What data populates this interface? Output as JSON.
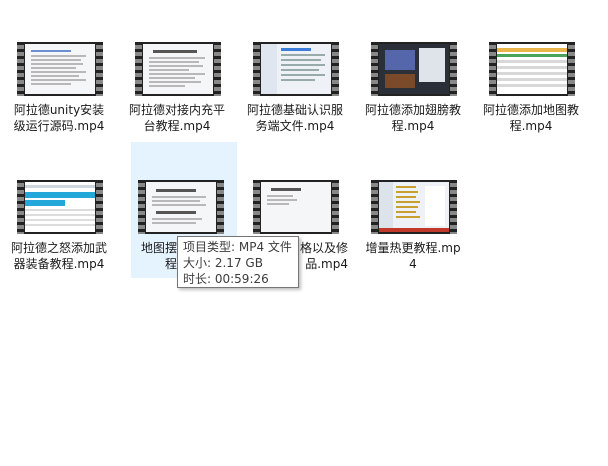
{
  "files": [
    {
      "label": "阿拉德unity安装级运行源码.mp4",
      "thumb": "doc-table"
    },
    {
      "label": "阿拉德对接内充平台教程.mp4",
      "thumb": "doc-text"
    },
    {
      "label": "阿拉德基础认识服务端文件.mp4",
      "thumb": "file-explorer"
    },
    {
      "label": "阿拉德添加翅膀教程.mp4",
      "thumb": "dark-app"
    },
    {
      "label": "阿拉德添加地图教程.mp4",
      "thumb": "spreadsheet"
    },
    {
      "label": "阿拉德之怒添加武器装备教程.mp4",
      "thumb": "spreadsheet-cyan"
    },
    {
      "label": "地图摆放怪物教程.mp4",
      "thumb": "doc-text2"
    },
    {
      "label": "修改物品价格以及修改物品.mp4",
      "thumb": "doc-text3"
    },
    {
      "label": "增量热更教程.mp4",
      "thumb": "file-explorer2"
    }
  ],
  "selected_index": 6,
  "tooltip": {
    "type_line": "项目类型: MP4 文件",
    "size_line": "大小: 2.17 GB",
    "duration_line": "时长: 00:59:26"
  },
  "visible_labels": {
    "f6_line1": "地图摆",
    "f6_line2": "程",
    "f7_line1": "格以及修",
    "f7_line2": "品.mp4"
  }
}
